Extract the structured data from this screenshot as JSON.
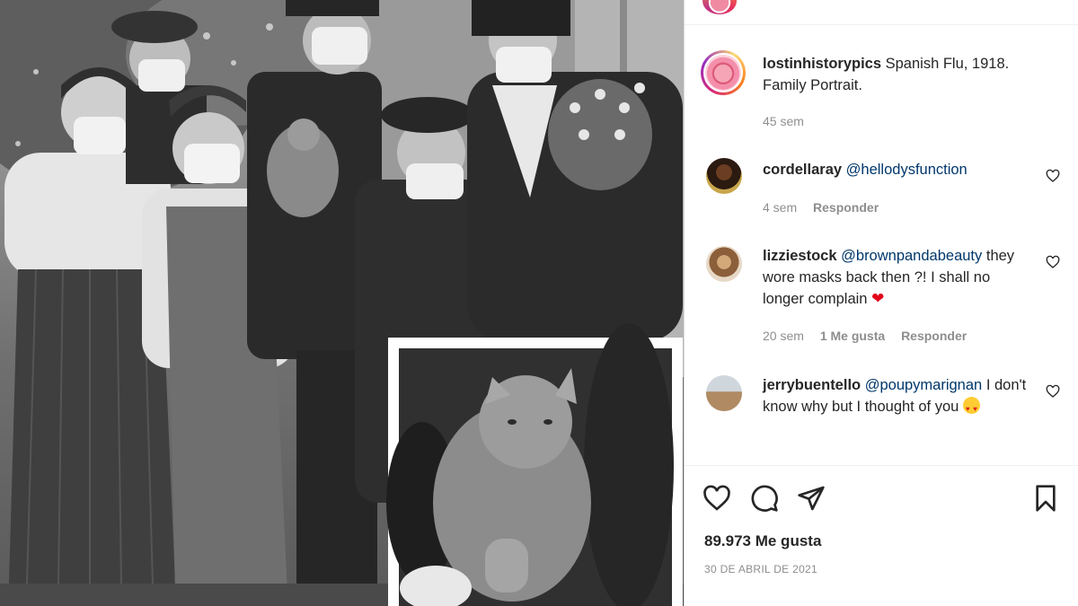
{
  "post": {
    "author": "lostinhistorypics",
    "caption": "Spanish Flu, 1918. Family Portrait.",
    "age": "45 sem",
    "avatar_icon": "lipstick-face-avatar"
  },
  "comments": [
    {
      "user": "cordellaray",
      "mention": "@hellodysfunction",
      "text": "",
      "age": "4 sem",
      "likes": "",
      "reply_label": "Responder"
    },
    {
      "user": "lizziestock",
      "mention": "@brownpandabeauty",
      "text": "they wore masks back then ?! I shall no longer complain",
      "emoji": "red-heart-emoji",
      "age": "20 sem",
      "likes": "1 Me gusta",
      "reply_label": "Responder"
    },
    {
      "user": "jerrybuentello",
      "mention": "@poupymarignan",
      "text": "I don't know why but I thought of you",
      "emoji": "heart-eyes-emoji",
      "age": "",
      "likes": "",
      "reply_label": ""
    }
  ],
  "actions": {
    "like_icon": "heart-outline-icon",
    "comment_icon": "speech-bubble-icon",
    "share_icon": "paper-plane-icon",
    "save_icon": "bookmark-icon"
  },
  "stats": {
    "likes": "89.973 Me gusta",
    "date": "30 DE ABRIL DE 2021"
  },
  "photo": {
    "description_icon": "vintage-family-photo",
    "inset_icon": "cat-closeup-inset"
  },
  "colors": {
    "mention": "#00376b",
    "muted": "#8e8e8e",
    "text": "#262626",
    "border": "#efefef"
  }
}
